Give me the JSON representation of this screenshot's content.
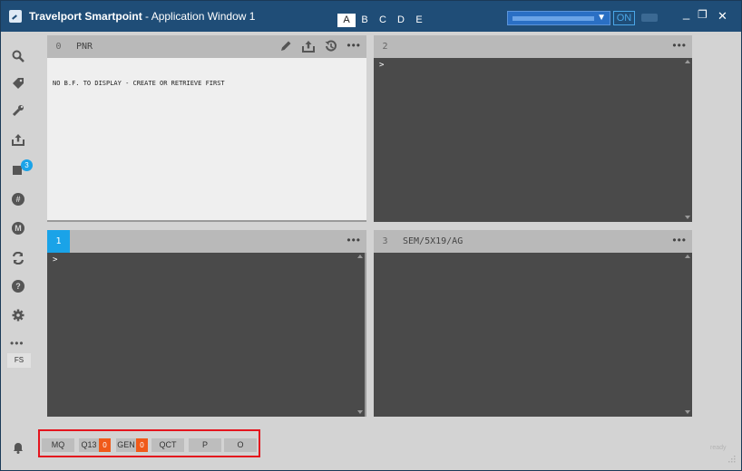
{
  "window": {
    "title_brand": "Travelport Smartpoint",
    "title_rest": " - Application Window 1",
    "area_tabs": [
      "A",
      "B",
      "C",
      "D",
      "E"
    ],
    "active_area": "A",
    "on_label": "ON",
    "minimize_glyph": "_",
    "restore_glyph": "❐",
    "close_glyph": "✕"
  },
  "sidebar": {
    "badge_count": "3",
    "hash_label": "#",
    "m_label": "M",
    "help_label": "?",
    "more_label": "•••",
    "fs_label": "FS"
  },
  "panels": {
    "p0": {
      "number": "0",
      "label": "PNR",
      "message": "NO B.F. TO DISPLAY - CREATE OR RETRIEVE FIRST",
      "menu": "•••"
    },
    "p1": {
      "number": "1",
      "label": "",
      "prompt": ">",
      "menu": "•••"
    },
    "p2": {
      "number": "2",
      "label": "",
      "prompt": ">",
      "menu": "•••"
    },
    "p3": {
      "number": "3",
      "label": "SEM/5X19/AG",
      "menu": "•••"
    }
  },
  "queue_bar": {
    "mq": "MQ",
    "q13": "Q13",
    "q13_count": "0",
    "gen": "GEN",
    "gen_count": "0",
    "qct": "QCT",
    "p": "P",
    "o": "O"
  },
  "status": {
    "ready": "ready"
  },
  "colors": {
    "titlebar": "#1f4d77",
    "accent": "#1aa3e8",
    "queue_count": "#f05a1a",
    "highlight_border": "#e4141d"
  }
}
